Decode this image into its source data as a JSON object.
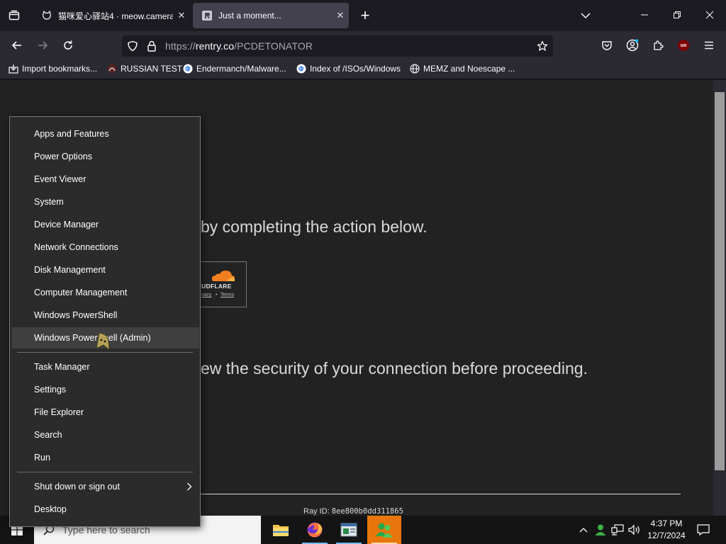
{
  "browser": {
    "tabs": [
      {
        "title": "猫咪爱心驿站4 · meow.camera",
        "active": false
      },
      {
        "title": "Just a moment...",
        "active": true
      }
    ],
    "new_tab_glyph": "+",
    "url": {
      "scheme": "https://",
      "host": "rentry.co",
      "path": "/PCDETONATOR"
    },
    "bookmarks": [
      {
        "label": "Import bookmarks...",
        "icon": "import-icon"
      },
      {
        "label": "RUSSIAN TEST",
        "icon": "site-favicon"
      },
      {
        "label": "Endermanch/Malware...",
        "icon": "google-icon"
      },
      {
        "label": "Index of /ISOs/Windows",
        "icon": "google-icon"
      },
      {
        "label": "MEMZ and Noescape ...",
        "icon": "globe-icon"
      }
    ],
    "extension_badge": "uo"
  },
  "page": {
    "line1": "by completing the action below.",
    "line2": "ew the security of your connection before proceeding.",
    "cloudflare_brand": "UDFLARE",
    "cloudflare_privacy": "vacy",
    "cloudflare_sep": "•",
    "cloudflare_terms": "Terms",
    "ray_label": "Ray ID:",
    "ray_value": "8ee800b0dd311865"
  },
  "winx_menu": {
    "group1": [
      "Apps and Features",
      "Power Options",
      "Event Viewer",
      "System",
      "Device Manager",
      "Network Connections",
      "Disk Management",
      "Computer Management",
      "Windows PowerShell",
      "Windows PowerShell (Admin)"
    ],
    "group2": [
      "Task Manager",
      "Settings",
      "File Explorer",
      "Search",
      "Run"
    ],
    "group3": [
      "Shut down or sign out",
      "Desktop"
    ],
    "hovered": "Windows PowerShell (Admin)"
  },
  "taskbar": {
    "search_placeholder": "Type here to search",
    "time": "4:37 PM",
    "date": "12/7/2024"
  },
  "colors": {
    "cloudflare_orange": "#f38020",
    "taskbar_accent": "#76b9ed",
    "adblock_red": "#800000"
  }
}
